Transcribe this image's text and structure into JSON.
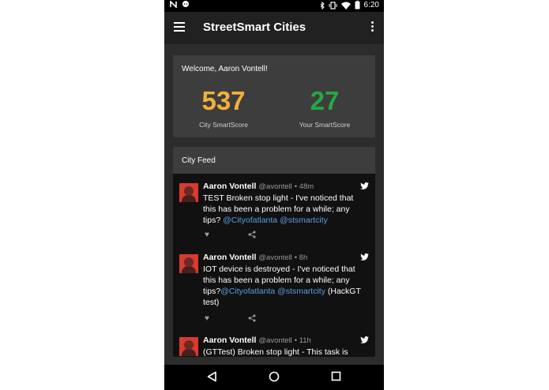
{
  "status_bar": {
    "left_icons": [
      "n-icon",
      "chat-icon"
    ],
    "right_icons": [
      "bluetooth-icon",
      "vibrate-icon",
      "wifi-icon",
      "battery-icon"
    ],
    "time": "6:20"
  },
  "app_bar": {
    "title": "StreetSmart Cities"
  },
  "welcome": {
    "greeting": "Welcome, Aaron Vontell!",
    "city_score": "537",
    "city_score_label": "City SmartScore",
    "city_score_color": "#f2b03c",
    "your_score": "27",
    "your_score_label": "Your SmartScore",
    "your_score_color": "#27a844"
  },
  "feed": {
    "title": "City Feed",
    "tweets": [
      {
        "name": "Aaron Vontell",
        "handle": "@avontell",
        "time": "• 48m",
        "text": "TEST Broken stop light - I've noticed that this has been a problem for a while; any tips? ",
        "links": "@Cityofatlanta @stsmartcity",
        "tail": ""
      },
      {
        "name": "Aaron Vontell",
        "handle": "@avontell",
        "time": "• 8h",
        "text": "IOT device is destroyed - I've noticed that this has been a problem for a while; any tips?",
        "links": "@Cityofatlanta @stsmartcity",
        "tail": " (HackGT test)"
      },
      {
        "name": "Aaron Vontell",
        "handle": "@avontell",
        "time": "• 11h",
        "text": "(GTTest) Broken stop light - This task is also",
        "links": "",
        "tail": ""
      }
    ]
  },
  "nav_bar": {
    "buttons": [
      "back-icon",
      "home-icon",
      "recents-icon"
    ]
  }
}
